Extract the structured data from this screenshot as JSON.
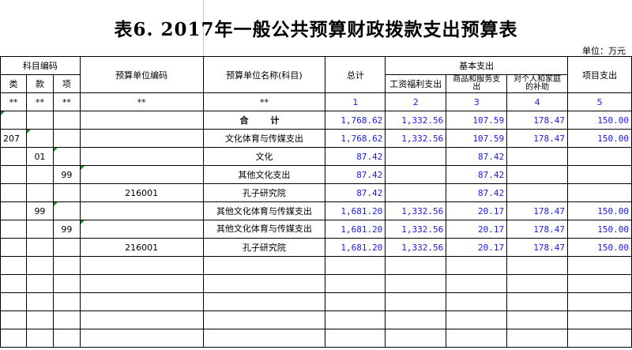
{
  "title": "表6. 2017年一般公共预算财政拨款支出预算表",
  "unit": "单位：万元",
  "headers": {
    "subject_code": "科目编码",
    "lei": "类",
    "kuan": "款",
    "xiang": "项",
    "unit_code": "预算单位编码",
    "unit_name": "预算单位名称(科目)",
    "total": "总计",
    "basic": "基本支出",
    "salary": "工资福利支出",
    "goods": "商品和服务支出",
    "personal": "对个人和家庭的补助",
    "project": "项目支出"
  },
  "index_row": [
    "**",
    "**",
    "**",
    "**",
    "**",
    "1",
    "2",
    "3",
    "4",
    "5"
  ],
  "rows": [
    {
      "lei": "",
      "kuan": "",
      "xiang": "",
      "code": "",
      "name": "合 计",
      "total": "1,768.62",
      "salary": "1,332.56",
      "goods": "107.59",
      "personal": "178.47",
      "project": "150.00"
    },
    {
      "lei": "207",
      "kuan": "",
      "xiang": "",
      "code": "",
      "name": "文化体育与传媒支出",
      "total": "1,768.62",
      "salary": "1,332.56",
      "goods": "107.59",
      "personal": "178.47",
      "project": "150.00"
    },
    {
      "lei": "",
      "kuan": "01",
      "xiang": "",
      "code": "",
      "name": "文化",
      "total": "87.42",
      "salary": "",
      "goods": "87.42",
      "personal": "",
      "project": ""
    },
    {
      "lei": "",
      "kuan": "",
      "xiang": "99",
      "code": "",
      "name": "其他文化支出",
      "total": "87.42",
      "salary": "",
      "goods": "87.42",
      "personal": "",
      "project": ""
    },
    {
      "lei": "",
      "kuan": "",
      "xiang": "",
      "code": "216001",
      "name": "孔子研究院",
      "total": "87.42",
      "salary": "",
      "goods": "87.42",
      "personal": "",
      "project": ""
    },
    {
      "lei": "",
      "kuan": "99",
      "xiang": "",
      "code": "",
      "name": "其他文化体育与传媒支出",
      "total": "1,681.20",
      "salary": "1,332.56",
      "goods": "20.17",
      "personal": "178.47",
      "project": "150.00"
    },
    {
      "lei": "",
      "kuan": "",
      "xiang": "99",
      "code": "",
      "name": "其他文化体育与传媒支出",
      "total": "1,681.20",
      "salary": "1,332.56",
      "goods": "20.17",
      "personal": "178.47",
      "project": "150.00"
    },
    {
      "lei": "",
      "kuan": "",
      "xiang": "",
      "code": "216001",
      "name": "孔子研究院",
      "total": "1,681.20",
      "salary": "1,332.56",
      "goods": "20.17",
      "personal": "178.47",
      "project": "150.00"
    }
  ]
}
